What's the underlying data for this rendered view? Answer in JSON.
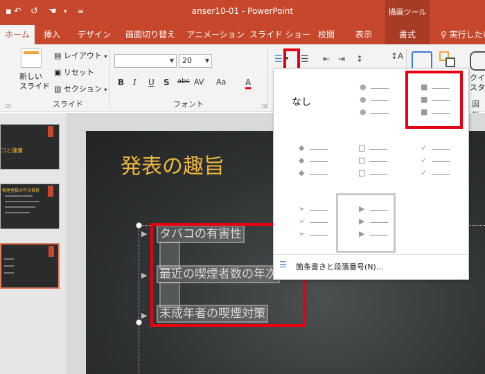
{
  "titlebar": {
    "title": "anser10-01  -  PowerPoint",
    "context_group": "描画ツール"
  },
  "tabs": [
    {
      "label": "ホーム"
    },
    {
      "label": "挿入"
    },
    {
      "label": "デザイン"
    },
    {
      "label": "画面切り替え"
    },
    {
      "label": "アニメーション"
    },
    {
      "label": "スライド ショー"
    },
    {
      "label": "校閲"
    },
    {
      "label": "表示"
    },
    {
      "label": "書式"
    },
    {
      "label": "実行したい"
    }
  ],
  "ribbon": {
    "new_slide": "新しい\nスライド",
    "layout": "レイアウト",
    "reset": "リセット",
    "section": "セクション",
    "group_slide": "スライド",
    "group_font": "フォント",
    "group_figure": "図形",
    "quick_style": "クイック\nスタイル",
    "font_name": "",
    "font_size": "20",
    "bold": "B",
    "italic": "I",
    "underline": "U",
    "shadow": "S",
    "strike": "abc",
    "spacing": "AV",
    "case": "Aa",
    "font_color": "A"
  },
  "gallery": {
    "none_label": "なし",
    "footer_label": "箇条書きと段落番号(N)..."
  },
  "slides": [
    {
      "label": "コと健康"
    },
    {
      "label": "喫煙者数の年次推移"
    },
    {
      "label": ""
    }
  ],
  "slide": {
    "title": "発表の趣旨",
    "bullets": [
      "タバコの有害性",
      "最近の喫煙者数の年次",
      "未成年者の喫煙対策"
    ]
  },
  "colors": {
    "accent": "#c6472b",
    "highlight": "#e60012",
    "title": "#f0b73c"
  }
}
